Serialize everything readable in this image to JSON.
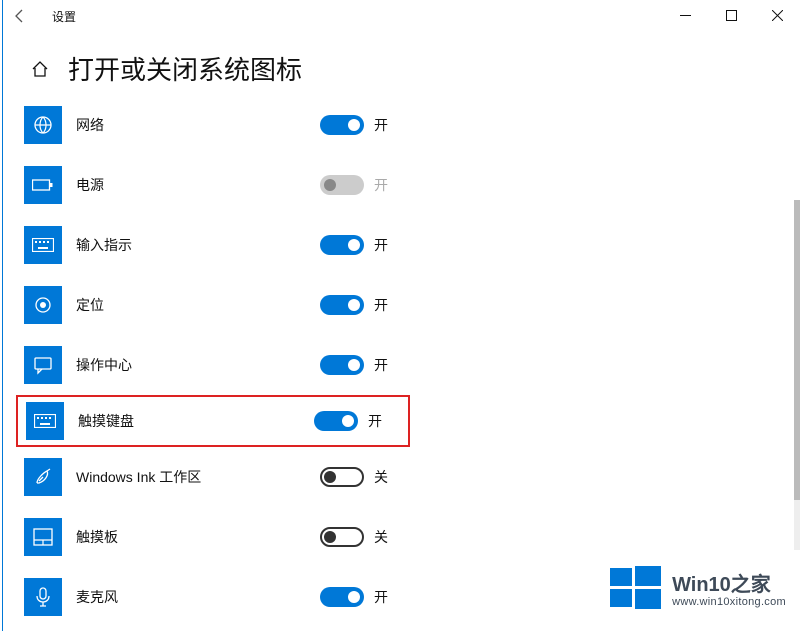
{
  "titlebar": {
    "app_title": "设置"
  },
  "header": {
    "page_title": "打开或关闭系统图标"
  },
  "toggle_text": {
    "on": "开",
    "off": "关"
  },
  "items": [
    {
      "key": "network",
      "label": "网络",
      "state": "on",
      "icon": "globe-icon"
    },
    {
      "key": "power",
      "label": "电源",
      "state": "disabled",
      "icon": "battery-icon"
    },
    {
      "key": "ime",
      "label": "输入指示",
      "state": "on",
      "icon": "keyboard-icon"
    },
    {
      "key": "location",
      "label": "定位",
      "state": "on",
      "icon": "location-icon"
    },
    {
      "key": "action-center",
      "label": "操作中心",
      "state": "on",
      "icon": "chat-icon"
    },
    {
      "key": "touch-kbd",
      "label": "触摸键盘",
      "state": "on",
      "icon": "keyboard-icon",
      "highlight": true
    },
    {
      "key": "ink",
      "label": "Windows Ink 工作区",
      "state": "off",
      "icon": "pen-icon"
    },
    {
      "key": "touchpad",
      "label": "触摸板",
      "state": "off",
      "icon": "touchpad-icon"
    },
    {
      "key": "mic",
      "label": "麦克风",
      "state": "on",
      "icon": "mic-icon"
    }
  ],
  "watermark": {
    "title": "Win10之家",
    "url": "www.win10xitong.com"
  }
}
